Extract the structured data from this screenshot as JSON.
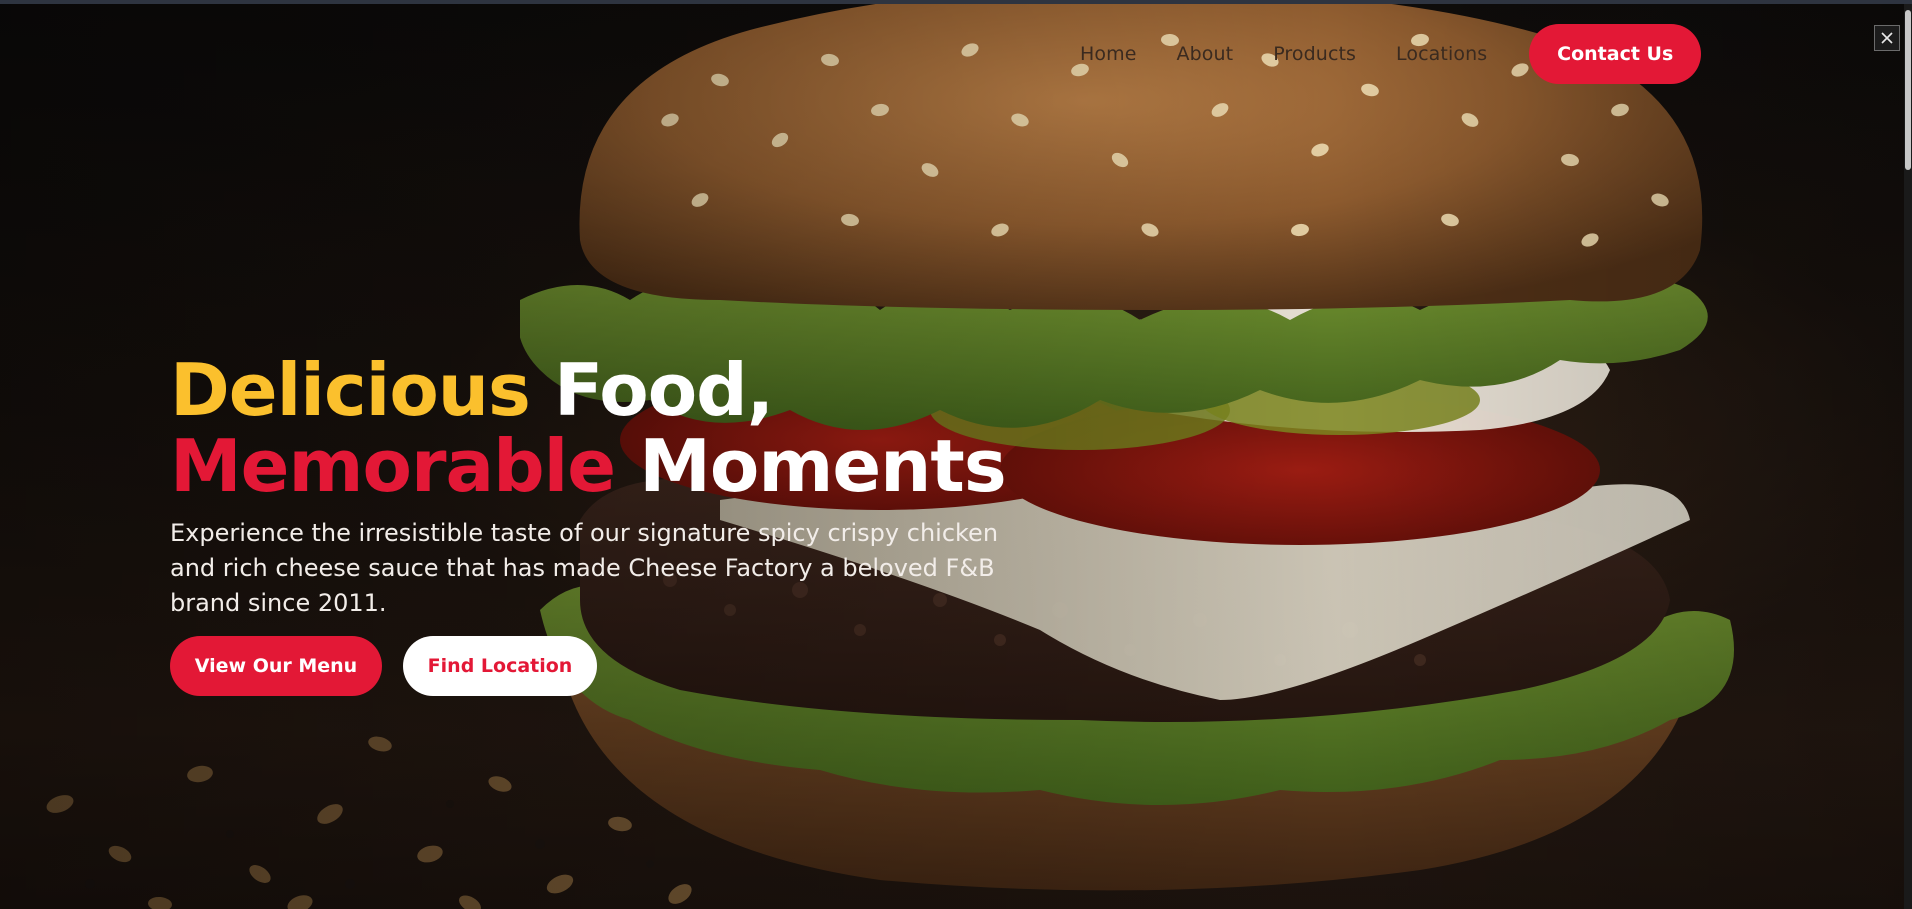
{
  "nav": {
    "items": [
      {
        "label": "Home"
      },
      {
        "label": "About"
      },
      {
        "label": "Products"
      },
      {
        "label": "Locations"
      }
    ],
    "contact_label": "Contact Us"
  },
  "hero": {
    "headline": {
      "word1": "Delicious",
      "word2": "Food,",
      "word3": "Memorable",
      "word4": "Moments"
    },
    "description": "Experience the irresistible taste of our signature spicy crispy chicken and rich cheese sauce that has made Cheese Factory a beloved F&B brand since 2011.",
    "buttons": {
      "primary": "View Our Menu",
      "secondary": "Find Location"
    },
    "background_image": "burger-photo"
  },
  "overlay": {
    "close_icon": "close-icon"
  },
  "colors": {
    "accent_red": "#e31836",
    "accent_yellow": "#fbc02d",
    "text_light": "#ffffff"
  }
}
